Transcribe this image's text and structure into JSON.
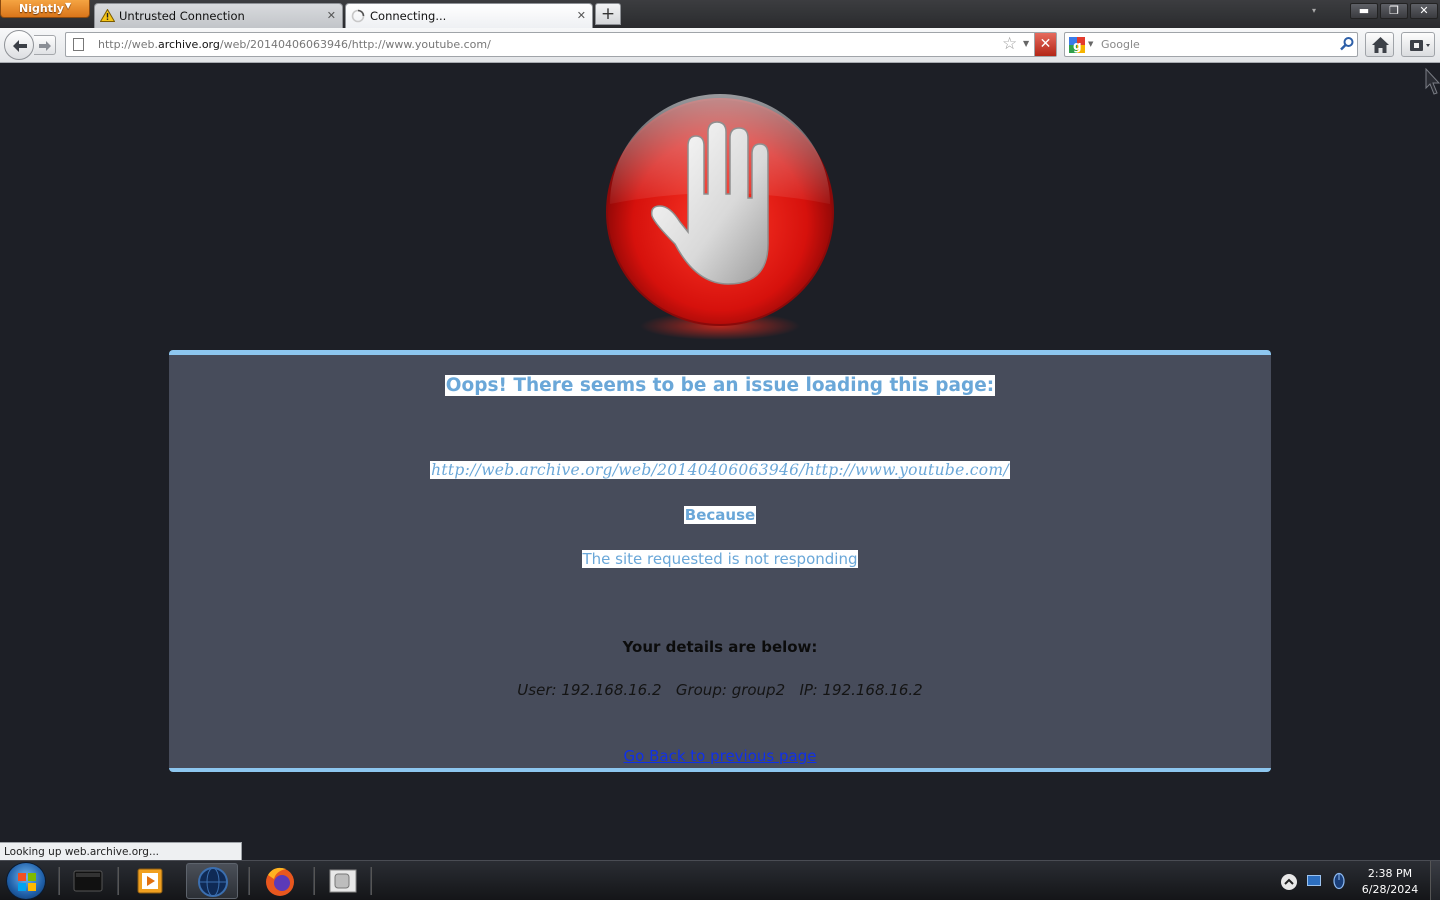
{
  "browser": {
    "app_menu_label": "Nightly",
    "tabs": [
      {
        "title": "Untrusted Connection",
        "icon": "warning-icon"
      },
      {
        "title": "Connecting...",
        "icon": "loading-spinner-icon"
      }
    ],
    "new_tab_label": "+",
    "window_controls": {
      "minimize": "▬",
      "maximize": "❐",
      "close": "✕"
    },
    "url": {
      "prefix": "http://web.",
      "domain": "archive.org",
      "path": "/web/20140406063946/http://www.youtube.com/"
    },
    "search": {
      "engine": "Google",
      "placeholder": "Google"
    },
    "status_text": "Looking up web.archive.org..."
  },
  "page": {
    "title": "Oops! There seems to be an issue loading this page:",
    "url": "http://web.archive.org/web/20140406063946/http://www.youtube.com/",
    "because_label": "Because",
    "reason": "The site requested is not responding",
    "details_heading": "Your details are below:",
    "details": {
      "user_label": "User:",
      "user": "192.168.16.2",
      "group_label": "Group:",
      "group": "group2",
      "ip_label": "IP:",
      "ip": "192.168.16.2"
    },
    "back_link": "Go Back to previous page",
    "colors": {
      "panel": "#474c5b",
      "accent": "#8dc6ef",
      "highlight_text": "#6aa7d8",
      "link": "#1030e8",
      "stop_red": "#e11a1a"
    }
  },
  "taskbar": {
    "items": [
      "start-orb",
      "terminal-app",
      "media-player-app",
      "browser-globe-app",
      "firefox-app",
      "file-app"
    ],
    "clock": {
      "time": "2:38 PM",
      "date": "6/28/2024"
    }
  }
}
